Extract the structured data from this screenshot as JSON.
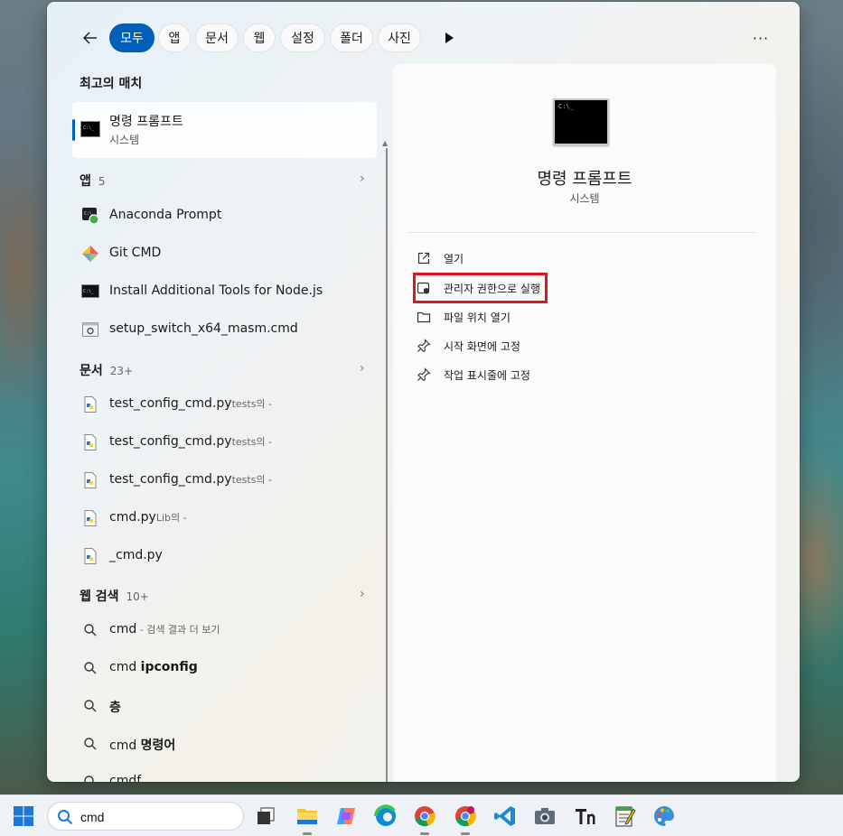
{
  "filters": {
    "back_label": "back",
    "chips": [
      "모두",
      "앱",
      "문서",
      "웹",
      "설정",
      "폴더",
      "사진"
    ],
    "active": "모두",
    "more": "···"
  },
  "best_match": {
    "heading": "최고의 매치",
    "title": "명령 프롬프트",
    "subtitle": "시스템"
  },
  "apps": {
    "heading": "앱",
    "count": "5",
    "items": [
      {
        "label": "Anaconda Prompt"
      },
      {
        "label": "Git CMD"
      },
      {
        "label": "Install Additional Tools for Node.js"
      },
      {
        "label": "setup_switch_x64_masm.cmd"
      }
    ]
  },
  "documents": {
    "heading": "문서",
    "count": "23+",
    "items": [
      {
        "label": "test_config_cmd.py",
        "suffix": "tests의 -"
      },
      {
        "label": "test_config_cmd.py",
        "suffix": "tests의 -"
      },
      {
        "label": "test_config_cmd.py",
        "suffix": "tests의 -"
      },
      {
        "label": "cmd.py",
        "suffix": "Lib의 -"
      },
      {
        "label": "_cmd.py",
        "suffix": ""
      }
    ]
  },
  "web": {
    "heading": "웹 검색",
    "count": "10+",
    "items": [
      {
        "prefix": "cmd",
        "rest": " - 검색 결과 더 보기",
        "bold": ""
      },
      {
        "prefix": "cmd ",
        "rest": "",
        "bold": "ipconfig"
      },
      {
        "prefix": "",
        "rest": "",
        "bold": "층"
      },
      {
        "prefix": "cmd ",
        "rest": "",
        "bold": "명령어"
      },
      {
        "prefix": "cmdf",
        "rest": "",
        "bold": ""
      }
    ]
  },
  "detail": {
    "title": "명령 프롬프트",
    "subtitle": "시스템",
    "actions": [
      "열기",
      "관리자 권한으로 실행",
      "파일 위치 열기",
      "시작 화면에 고정",
      "작업 표시줄에 고정"
    ]
  },
  "taskbar": {
    "search_value": "cmd"
  },
  "colors": {
    "accent": "#005fb8",
    "highlight": "#e0141e"
  }
}
